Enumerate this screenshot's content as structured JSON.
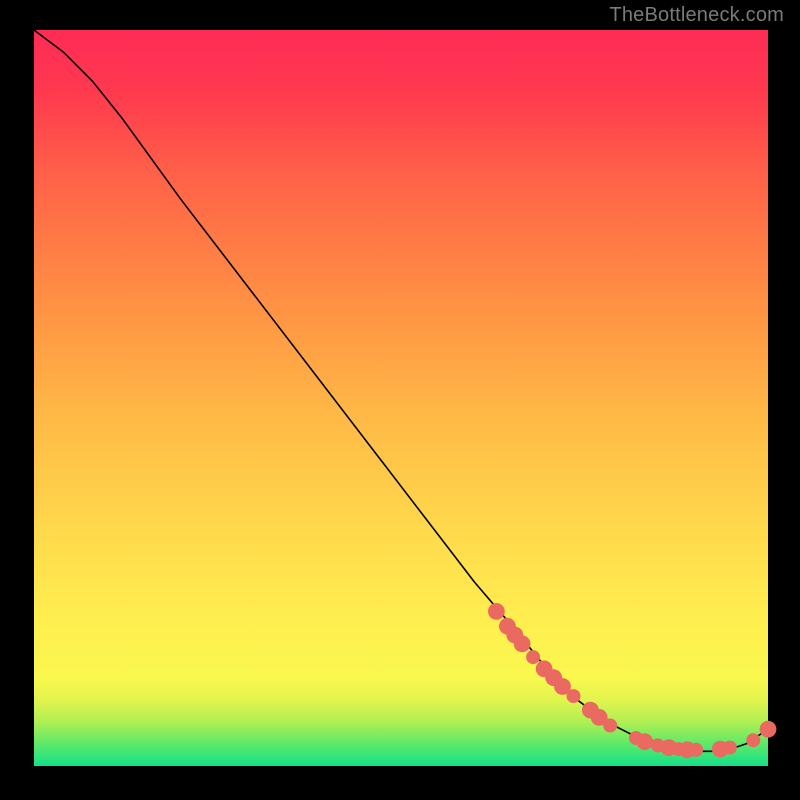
{
  "attribution": "TheBottleneck.com",
  "chart_data": {
    "type": "line",
    "title": "",
    "xlabel": "",
    "ylabel": "",
    "xlim": [
      0,
      100
    ],
    "ylim": [
      0,
      100
    ],
    "curve": {
      "name": "bottleneck-curve",
      "x": [
        0,
        4,
        8,
        12,
        20,
        30,
        40,
        50,
        60,
        66,
        70,
        74,
        78,
        82,
        86,
        90,
        94,
        97,
        100
      ],
      "y": [
        100,
        97,
        93,
        88,
        77,
        64,
        51,
        38,
        25,
        18,
        13,
        9,
        6,
        4,
        3,
        2,
        2,
        3,
        5
      ]
    },
    "markers": {
      "name": "highlighted-range",
      "color": "#ea6a61",
      "points": [
        {
          "x": 63.0,
          "y": 21.0,
          "r": 1.2
        },
        {
          "x": 64.5,
          "y": 19.0,
          "r": 1.2
        },
        {
          "x": 65.5,
          "y": 17.8,
          "r": 1.2
        },
        {
          "x": 66.5,
          "y": 16.6,
          "r": 1.2
        },
        {
          "x": 68.0,
          "y": 14.8,
          "r": 1.0
        },
        {
          "x": 69.5,
          "y": 13.2,
          "r": 1.2
        },
        {
          "x": 70.8,
          "y": 12.0,
          "r": 1.2
        },
        {
          "x": 72.0,
          "y": 10.8,
          "r": 1.2
        },
        {
          "x": 73.5,
          "y": 9.5,
          "r": 1.0
        },
        {
          "x": 75.8,
          "y": 7.6,
          "r": 1.2
        },
        {
          "x": 77.0,
          "y": 6.6,
          "r": 1.2
        },
        {
          "x": 78.5,
          "y": 5.5,
          "r": 1.0
        },
        {
          "x": 82.0,
          "y": 3.8,
          "r": 1.0
        },
        {
          "x": 83.2,
          "y": 3.3,
          "r": 1.2
        },
        {
          "x": 85.0,
          "y": 2.8,
          "r": 1.0
        },
        {
          "x": 86.5,
          "y": 2.5,
          "r": 1.2
        },
        {
          "x": 87.8,
          "y": 2.3,
          "r": 1.0
        },
        {
          "x": 89.0,
          "y": 2.2,
          "r": 1.2
        },
        {
          "x": 90.2,
          "y": 2.2,
          "r": 1.0
        },
        {
          "x": 93.5,
          "y": 2.3,
          "r": 1.2
        },
        {
          "x": 94.8,
          "y": 2.5,
          "r": 1.0
        },
        {
          "x": 98.0,
          "y": 3.5,
          "r": 1.0
        },
        {
          "x": 100.0,
          "y": 5.0,
          "r": 1.2
        }
      ]
    }
  }
}
